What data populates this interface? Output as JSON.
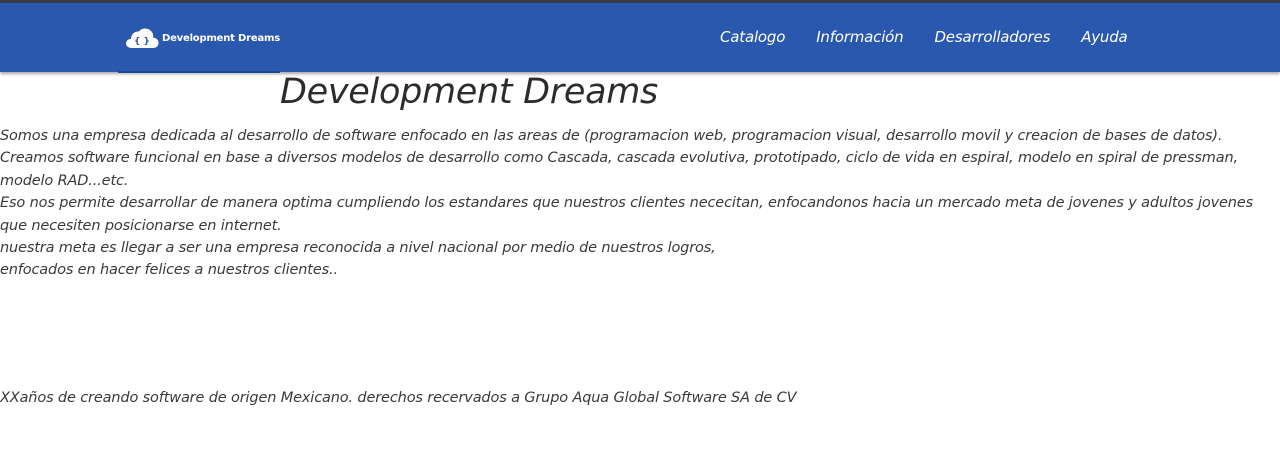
{
  "navbar": {
    "brand_icon": "cloud-code-icon",
    "brand_icon_glyph": "{ }",
    "brand_name": "Development Dreams",
    "links": [
      "Catalogo",
      "Información",
      "Desarrolladores",
      "Ayuda"
    ],
    "background_color": "#2a58ae"
  },
  "main": {
    "title": "Development Dreams",
    "lines": [
      "Somos una empresa dedicada al desarrollo de software enfocado en las areas de (programacion web, programacion visual, desarrollo movil y creacion de bases de datos).",
      "Creamos software funcional en base a diversos modelos de desarrollo como Cascada, cascada evolutiva, prototipado, ciclo de vida en espiral, modelo en spiral de pressman,",
      "modelo RAD...etc.",
      "Eso nos permite desarrollar de manera optima cumpliendo los estandares que nuestros clientes nececitan, enfocandonos hacia un mercado meta de jovenes y adultos jovenes",
      "que necesiten posicionarse en internet.",
      "nuestra meta es llegar a ser una empresa reconocida a nivel nacional por medio de nuestros logros,",
      "enfocados en hacer felices a nuestros clientes.."
    ]
  },
  "footer": {
    "text": "XXaños de creando software de origen Mexicano. derechos recervados a Grupo Aqua Global Software SA de CV"
  }
}
